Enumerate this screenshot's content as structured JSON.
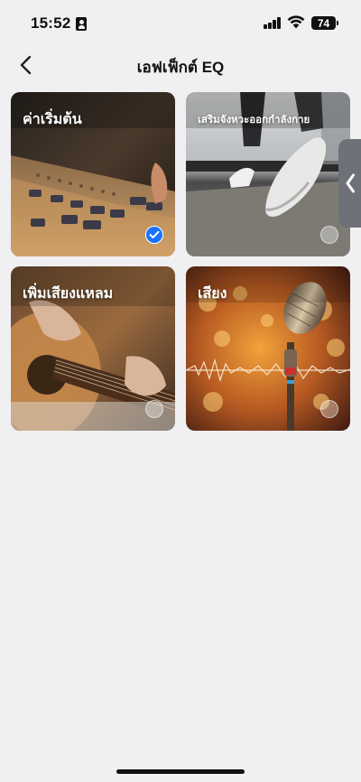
{
  "status_bar": {
    "time": "15:52",
    "battery": "74",
    "icons": [
      "id-card-icon",
      "signal-icon",
      "wifi-icon",
      "battery-icon"
    ]
  },
  "header": {
    "title": "เอฟเฟ็กต์ EQ",
    "back_icon": "chevron-left-icon"
  },
  "effects": [
    {
      "label": "ค่าเริ่มต้น",
      "selected": true
    },
    {
      "label": "เสริมจังหวะออกกำลังกาย",
      "selected": false
    },
    {
      "label": "เพิ่มเสียงแหลม",
      "selected": false
    },
    {
      "label": "เสียง",
      "selected": false
    }
  ],
  "side_handle": {
    "icon": "chevron-left-icon"
  },
  "colors": {
    "background": "#f0f0f2",
    "accent": "#1a73ff",
    "handle": "#6f7178"
  }
}
